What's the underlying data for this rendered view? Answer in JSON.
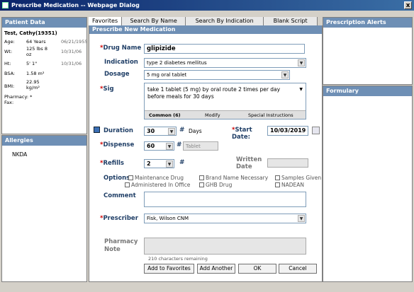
{
  "window": {
    "title": "Prescribe Medication -- Webpage Dialog",
    "close": "x"
  },
  "patient": {
    "header": "Patient Data",
    "name": "Test, Cathy(19351)",
    "age_label": "Age:",
    "age_value": "64 Years",
    "age_date": "06/21/1955",
    "wt_label": "Wt:",
    "wt_value": "125 lbs 8 oz",
    "wt_date": "10/31/06",
    "ht_label": "Ht:",
    "ht_value": "5' 1\"",
    "ht_date": "10/31/06",
    "bsa_label": "BSA:",
    "bsa_value": "1.58 m²",
    "bmi_label": "BMI:",
    "bmi_value": "22.95 kg/m²",
    "pharmacy_label": "Pharmacy: *",
    "fax_label": "Fax:"
  },
  "allergies": {
    "header": "Allergies",
    "value": "NKDA"
  },
  "tabs": [
    {
      "label": "Favorites",
      "active": true
    },
    {
      "label": "Search By Name",
      "active": false
    },
    {
      "label": "Search By Indication",
      "active": false
    },
    {
      "label": "Blank Script",
      "active": false
    }
  ],
  "form": {
    "header": "Prescribe New Medication",
    "drug_label": "Drug Name",
    "drug_value": "glipizide",
    "indication_label": "Indication",
    "indication_value": "type 2 diabetes mellitus",
    "dosage_label": "Dosage",
    "dosage_value": "5 mg oral tablet",
    "sig_label": "Sig",
    "sig_value": "take 1 tablet (5 mg) by oral route 2 times per day before meals for 30 days",
    "sig_common": "Common (6)",
    "sig_modify": "Modify",
    "sig_special": "Special Instructions",
    "duration_label": "Duration",
    "duration_value": "30",
    "duration_unit": "Days",
    "start_label": "Start Date:",
    "start_value": "10/03/2019",
    "dispense_label": "Dispense",
    "dispense_value": "60",
    "dispense_unit": "Tablet",
    "refills_label": "Refills",
    "refills_value": "2",
    "written_label": "Written Date",
    "options_label": "Options",
    "opt_maintenance": "Maintenance Drug",
    "opt_brand": "Brand Name Necessary",
    "opt_samples": "Samples Given",
    "opt_administered": "Administered In Office",
    "opt_ghb": "GHB Drug",
    "opt_nadean": "NADEAN",
    "comment_label": "Comment",
    "prescriber_label": "Prescriber",
    "prescriber_value": "Fisk, Wilson CNM",
    "pharmacy_note_label": "Pharmacy Note",
    "chars_remaining": "210 characters remaining",
    "hash": "#"
  },
  "buttons": {
    "add_favorites": "Add to Favorites",
    "add_another": "Add Another",
    "ok": "OK",
    "cancel": "Cancel"
  },
  "alerts": {
    "header": "Prescription Alerts"
  },
  "formulary": {
    "header": "Formulary"
  }
}
